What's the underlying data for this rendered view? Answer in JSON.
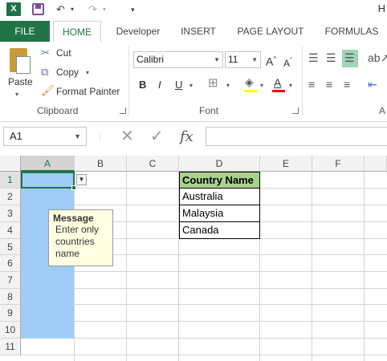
{
  "app": {
    "title": "H",
    "logo": "X"
  },
  "quick_access": {
    "undo_icon": "undo-icon",
    "redo_icon": "redo-icon",
    "customize_icon": "customize-icon"
  },
  "tabs": [
    {
      "label": "FILE"
    },
    {
      "label": "HOME"
    },
    {
      "label": "Developer"
    },
    {
      "label": "INSERT"
    },
    {
      "label": "PAGE LAYOUT"
    },
    {
      "label": "FORMULAS"
    }
  ],
  "clipboard": {
    "group_label": "Clipboard",
    "paste_label": "Paste",
    "cut_label": "Cut",
    "copy_label": "Copy",
    "format_painter_label": "Format Painter"
  },
  "font": {
    "group_label": "Font",
    "family": "Calibri",
    "size": "11",
    "bold": "B",
    "italic": "I",
    "underline": "U",
    "highlight_color": "#ffff00",
    "font_color": "#ff0000"
  },
  "alignment": {
    "group_label": "A"
  },
  "formula_bar": {
    "name_box": "A1",
    "fx_label": "fx",
    "cancel_symbol": "✕",
    "enter_symbol": "✓",
    "value": ""
  },
  "grid": {
    "columns": [
      "A",
      "B",
      "C",
      "D",
      "E",
      "F"
    ],
    "rows": [
      "1",
      "2",
      "3",
      "4",
      "5",
      "6",
      "7",
      "8",
      "9",
      "10",
      "11"
    ],
    "selected_column": "A",
    "selected_row": "1",
    "table": {
      "header": "Country Name",
      "values": [
        "Australia",
        "Malaysia",
        "Canada"
      ]
    },
    "input_message": {
      "title": "Message",
      "body": "Enter only countries name"
    }
  },
  "colors": {
    "accent": "#217346",
    "selection": "#9fcdf8",
    "table_header": "#a9d08e"
  }
}
